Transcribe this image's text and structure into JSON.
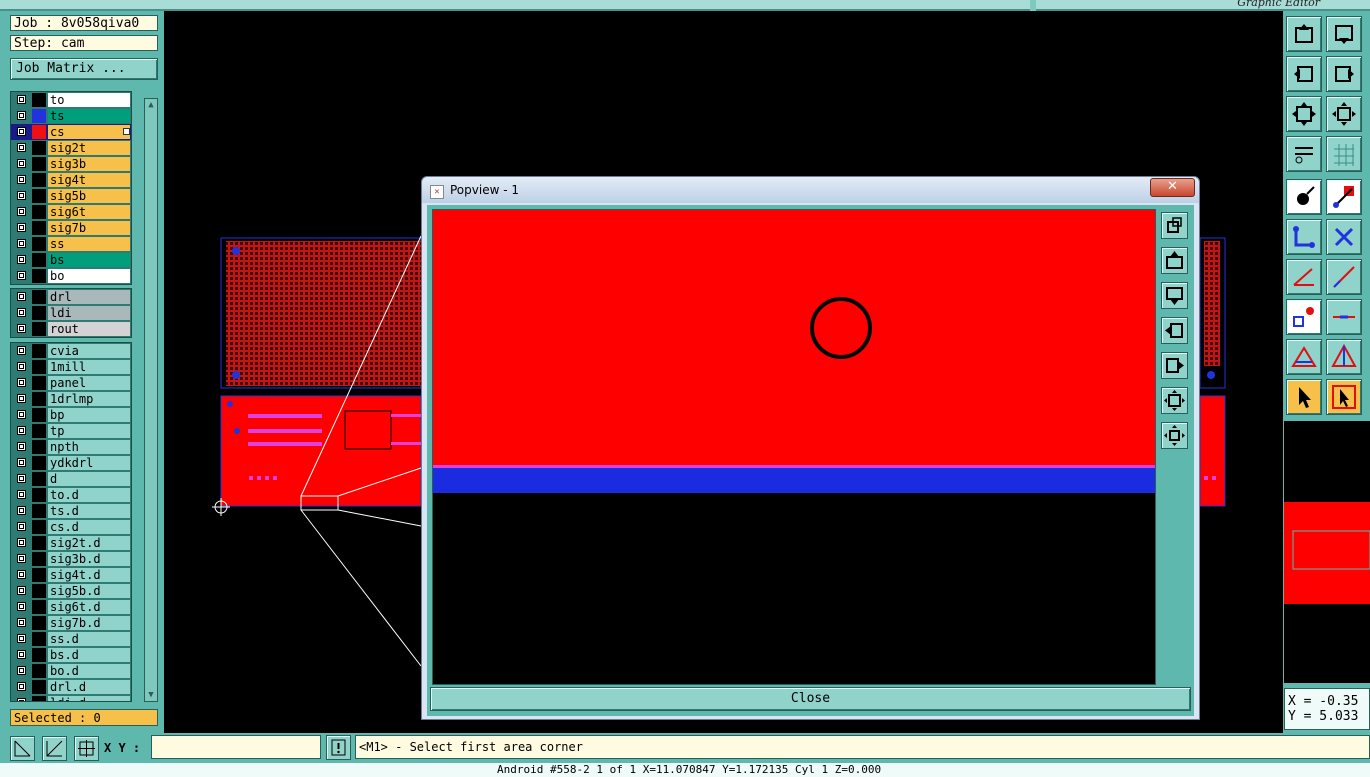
{
  "topbar": {
    "editor_title": "Graphic Editor"
  },
  "job": {
    "label": "Job : 8v058qiva0",
    "step": "Step: cam",
    "matrix_button": "Job Matrix ..."
  },
  "layers": {
    "board": [
      {
        "name": "to",
        "swatch": "#000000",
        "bg": "#ffffff"
      },
      {
        "name": "ts",
        "swatch": "#2233dd",
        "bg": "#009e7a"
      },
      {
        "name": "cs",
        "swatch": "#ee1111",
        "bg": "#f6c04a",
        "active": true
      },
      {
        "name": "sig2t",
        "swatch": "#000000",
        "bg": "#f6c04a"
      },
      {
        "name": "sig3b",
        "swatch": "#000000",
        "bg": "#f6c04a"
      },
      {
        "name": "sig4t",
        "swatch": "#000000",
        "bg": "#f6c04a"
      },
      {
        "name": "sig5b",
        "swatch": "#000000",
        "bg": "#f6c04a"
      },
      {
        "name": "sig6t",
        "swatch": "#000000",
        "bg": "#f6c04a"
      },
      {
        "name": "sig7b",
        "swatch": "#000000",
        "bg": "#f6c04a"
      },
      {
        "name": "ss",
        "swatch": "#000000",
        "bg": "#f6c04a"
      },
      {
        "name": "bs",
        "swatch": "#000000",
        "bg": "#009e7a"
      },
      {
        "name": "bo",
        "swatch": "#000000",
        "bg": "#ffffff"
      }
    ],
    "drill": [
      {
        "name": "drl",
        "swatch": "#000000",
        "bg": "#a9b8bb"
      },
      {
        "name": "ldi",
        "swatch": "#000000",
        "bg": "#a9b8bb"
      },
      {
        "name": "rout",
        "swatch": "#000000",
        "bg": "#d3d3d3"
      }
    ],
    "misc": [
      {
        "name": "cvia"
      },
      {
        "name": "1mill"
      },
      {
        "name": "panel"
      },
      {
        "name": "1drlmp"
      },
      {
        "name": "bp"
      },
      {
        "name": "tp"
      },
      {
        "name": "npth"
      },
      {
        "name": "ydkdrl"
      },
      {
        "name": "d"
      },
      {
        "name": "to.d"
      },
      {
        "name": "ts.d"
      },
      {
        "name": "cs.d"
      },
      {
        "name": "sig2t.d"
      },
      {
        "name": "sig3b.d"
      },
      {
        "name": "sig4t.d"
      },
      {
        "name": "sig5b.d"
      },
      {
        "name": "sig6t.d"
      },
      {
        "name": "sig7b.d"
      },
      {
        "name": "ss.d"
      },
      {
        "name": "bs.d"
      },
      {
        "name": "bo.d"
      },
      {
        "name": "drl.d"
      },
      {
        "name": "ldi.d"
      }
    ]
  },
  "selected": "Selected : 0",
  "bottom": {
    "xy_label": "X Y :",
    "xy_value": "",
    "prompt": "<M1> - Select first area corner",
    "status": "Android  #558-2  1 of 1  X=11.070847  Y=1.172135  Cyl  1  Z=0.000"
  },
  "coords": {
    "x": "X = -0.35",
    "y": "Y = 5.033"
  },
  "popview": {
    "title": "Popview - 1",
    "close_label": "Close"
  },
  "colors": {
    "panel": "#5fb8ad",
    "button": "#8fd3ca",
    "copper": "#ff0000",
    "mask": "#1a2be0"
  }
}
